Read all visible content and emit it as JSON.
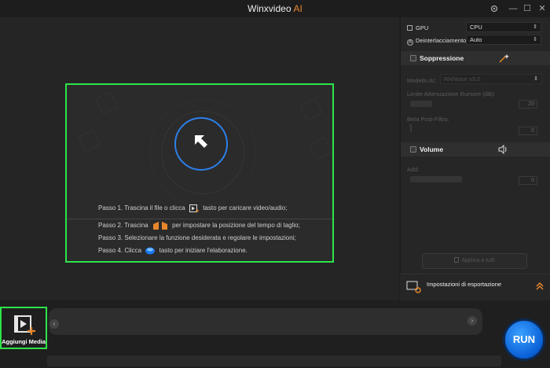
{
  "app": {
    "title": "Winxvideo",
    "title_accent": "AI"
  },
  "window_controls": {
    "settings_icon": "gear-icon",
    "minimize": "—",
    "maximize": "☐",
    "close": "✕"
  },
  "dropzone": {
    "steps": [
      {
        "before": "Passo 1. Trascina il file o clicca",
        "after": "tasto per caricare video/audio;"
      },
      {
        "before": "Passo 2. Trascina",
        "after": "per impostare la posizione del tempo di taglio;"
      },
      {
        "before": "Passo 3. Selezionare la funzione desiderata e regolare le impostazioni;",
        "after": ""
      },
      {
        "before": "Passo 4. Clicca",
        "after": "tasto per iniziare l'elaborazione."
      }
    ]
  },
  "sidebar": {
    "gpu_label": "GPU",
    "gpu_value": "CPU",
    "deinterlace_label": "Deinterlacciamento",
    "deinterlace_value": "Auto",
    "suppression": {
      "title": "Soppressione",
      "model_label": "Modello AI:",
      "model_value": "RNNoise v3.0",
      "attenuation_label": "Limite Attenuazione Rumore (dB):",
      "attenuation_value": "20",
      "beta_label": "Beta Post-Filtro:",
      "beta_value": "0"
    },
    "volume": {
      "title": "Volume",
      "add_label": "Add:",
      "add_value": "0"
    },
    "apply_all": "Applica a tutti",
    "export_settings": "Impostazioni di esportazione"
  },
  "bottom": {
    "add_media_label": "Aggiungi Media",
    "run_label": "RUN"
  },
  "colors": {
    "accent": "#e8862a",
    "highlight": "#2ee34a",
    "run_blue": "#1a78f0"
  }
}
